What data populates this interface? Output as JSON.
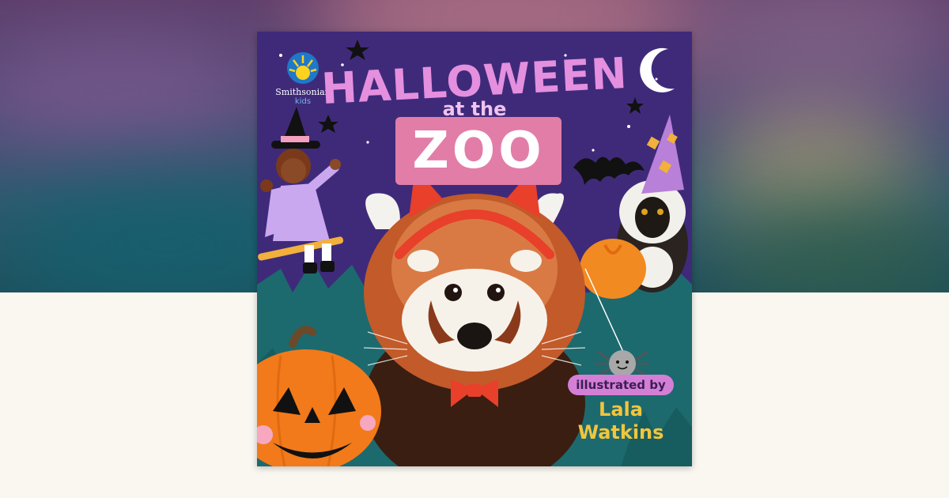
{
  "cover": {
    "publisher_name": "Smithsonian",
    "publisher_sub": "kids",
    "title_line1": "HALLOWEEN",
    "title_line2": "at the",
    "title_line3": "ZOO",
    "credit_label": "illustrated by",
    "credit_name_line1": "Lala",
    "credit_name_line2": "Watkins"
  },
  "colors": {
    "page_background": "#faf7f1",
    "cover_sky": "#3f2a7a",
    "grass": "#1c6a6e",
    "title_pink": "#e58fdf",
    "zoo_box": "#e27da8",
    "credit_yellow": "#f2c53d",
    "pumpkin_orange": "#f27a1a"
  }
}
